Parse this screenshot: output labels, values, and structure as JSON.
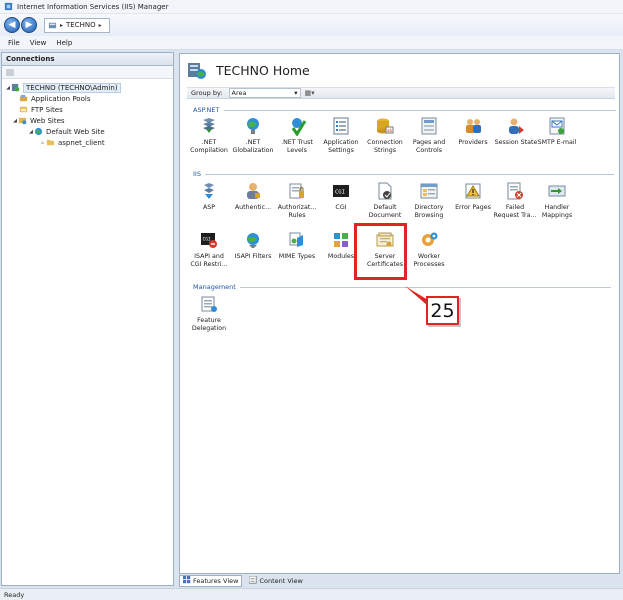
{
  "window": {
    "title": "Internet Information Services (IIS) Manager"
  },
  "address": {
    "segment": "TECHNO"
  },
  "menu": {
    "file": "File",
    "view": "View",
    "help": "Help"
  },
  "connections": {
    "header": "Connections",
    "tree": [
      {
        "label": "TECHNO (TECHNO\\Admin)",
        "icon": "server-icon"
      },
      {
        "label": "Application Pools",
        "icon": "app-pools-icon"
      },
      {
        "label": "FTP Sites",
        "icon": "ftp-sites-icon"
      },
      {
        "label": "Web Sites",
        "icon": "web-sites-icon"
      },
      {
        "label": "Default Web Site",
        "icon": "globe-icon"
      },
      {
        "label": "aspnet_client",
        "icon": "folder-icon"
      }
    ]
  },
  "content": {
    "title": "TECHNO Home",
    "group_by_label": "Group by:",
    "group_by_value": "Area",
    "sections": {
      "aspnet": "ASP.NET",
      "iis": "IIS",
      "management": "Management"
    },
    "aspnet_tiles": [
      ".NET\nCompilation",
      ".NET\nGlobalization",
      ".NET Trust\nLevels",
      "Application\nSettings",
      "Connection\nStrings",
      "Pages and\nControls",
      "Providers",
      "Session State",
      "SMTP E-mail"
    ],
    "iis_tiles_row1": [
      "ASP",
      "Authentic...",
      "Authorizat...\nRules",
      "CGI",
      "Default\nDocument",
      "Directory\nBrowsing",
      "Error Pages",
      "Failed\nRequest Tra...",
      "Handler\nMappings"
    ],
    "iis_tiles_row2": [
      "ISAPI and\nCGI Restri...",
      "ISAPI Filters",
      "MIME Types",
      "Modules",
      "Server\nCertificates",
      "Worker\nProcesses"
    ],
    "management_tiles": [
      "Feature\nDelegation"
    ],
    "callout": "25"
  },
  "bottom_tabs": {
    "features": "Features View",
    "content": "Content View"
  },
  "status": {
    "text": "Ready"
  },
  "colors": {
    "accent": "#1f57a4",
    "highlight": "#e02424"
  }
}
